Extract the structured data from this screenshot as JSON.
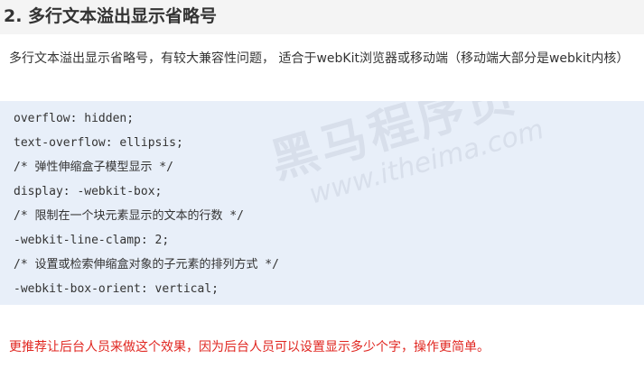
{
  "heading": "2. 多行文本溢出显示省略号",
  "intro": "多行文本溢出显示省略号，有较大兼容性问题， 适合于webKit浏览器或移动端（移动端大部分是webkit内核）",
  "code_lines": [
    "overflow: hidden;",
    "text-overflow: ellipsis;",
    "/* 弹性伸缩盒子模型显示 */",
    "display: -webkit-box;",
    "/* 限制在一个块元素显示的文本的行数 */",
    "-webkit-line-clamp: 2;",
    "/* 设置或检索伸缩盒对象的子元素的排列方式 */",
    "-webkit-box-orient: vertical;"
  ],
  "watermark": {
    "brand": "黑马程序员",
    "tm": "TM",
    "url": "www.itheima.com"
  },
  "note": "更推荐让后台人员来做这个效果，因为后台人员可以设置显示多少个字，操作更简单。",
  "colors": {
    "heading_bg": "#f4f4f4",
    "code_bg": "#e8eff9",
    "note_text": "#e0251f"
  }
}
